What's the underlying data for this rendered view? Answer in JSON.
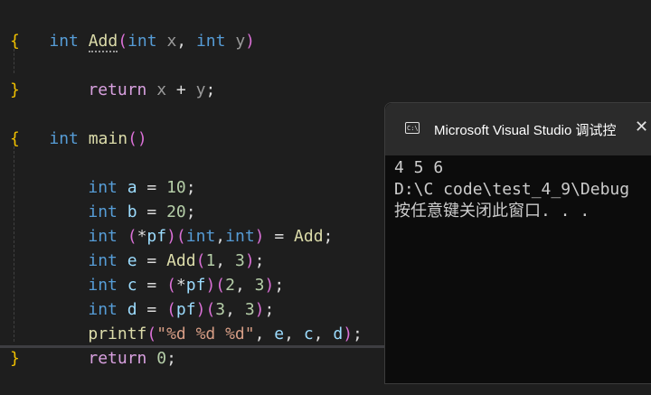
{
  "code": {
    "int": "int",
    "return": "return",
    "add_fn": "Add",
    "main_fn": "main",
    "printf_fn": "printf",
    "param_x": "x",
    "param_y": "y",
    "var_a": "a",
    "var_b": "b",
    "var_pf": "pf",
    "var_e": "e",
    "var_c": "c",
    "var_d": "d",
    "num_10": "10",
    "num_20": "20",
    "num_1": "1",
    "num_2": "2",
    "num_3": "3",
    "num_0": "0",
    "format_string": "\"%d %d %d\""
  },
  "console": {
    "title": "Microsoft Visual Studio 调试控",
    "icon": "console-app-icon",
    "icon_text": "C:\\",
    "close_glyph": "✕",
    "output": [
      "4 5 6",
      "D:\\C code\\test_4_9\\Debug",
      "按任意键关闭此窗口. . ."
    ]
  },
  "colors": {
    "editor_bg": "#1e1e1e",
    "keyword": "#569cd6",
    "control_keyword": "#d8a0df",
    "function": "#dcdcaa",
    "variable": "#9cdcfe",
    "number": "#b5cea8",
    "string": "#d69d85",
    "brace": "#f0c000",
    "console_bg": "#0c0c0c",
    "console_titlebar": "#2b2b2b"
  }
}
